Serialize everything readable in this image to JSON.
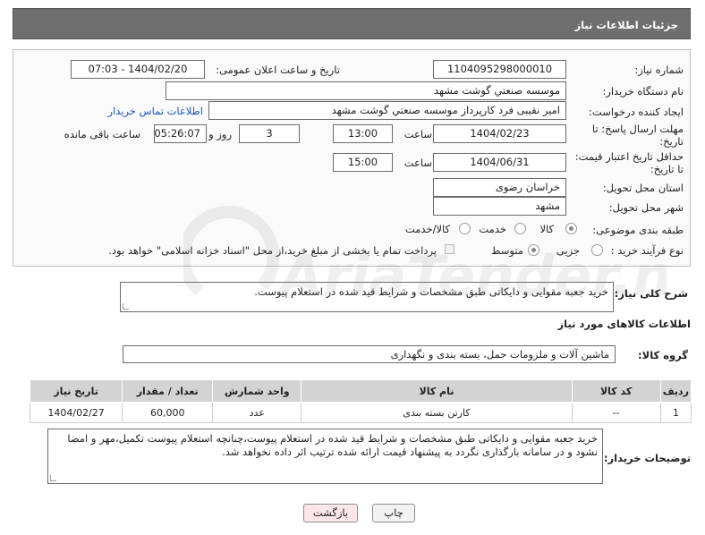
{
  "header": {
    "title": "جزئیات اطلاعات نیاز"
  },
  "form": {
    "need_number_label": "شماره نیاز:",
    "need_number": "1104095298000010",
    "announce_label": "تاریخ و ساعت اعلان عمومی:",
    "announce_value": "1404/02/20 - 07:03",
    "buyer_org_label": "نام دستگاه خریدار:",
    "buyer_org": "موسسه صنعتي گوشت مشهد",
    "requester_label": "ایجاد کننده درخواست:",
    "requester": "امیر نقیبی فرد کارپرداز موسسه صنعتي گوشت مشهد",
    "contact_link": "اطلاعات تماس خریدار",
    "deadline_label_1": "مهلت ارسال پاسخ: تا",
    "deadline_label_2": "تاریخ:",
    "deadline_date": "1404/02/23",
    "time_label": "ساعت",
    "deadline_time": "13:00",
    "days_value": "3",
    "days_label": "روز و",
    "remaining_time": "05:26:07",
    "remaining_label": "ساعت باقی مانده",
    "validity_label_1": "حداقل تاریخ اعتبار قیمت:",
    "validity_label_2": "تا تاریخ:",
    "validity_date": "1404/06/31",
    "validity_time": "15:00",
    "province_label": "استان محل تحویل:",
    "province": "خراسان رضوی",
    "city_label": "شهر محل تحویل:",
    "city": "مشهد",
    "category_label": "طبقه بندی موضوعی:",
    "category_options": [
      "کالا",
      "خدمت",
      "کالا/خدمت"
    ],
    "category_selected": 0,
    "process_label": "نوع فرآیند خرید :",
    "process_options": [
      "جزیی",
      "متوسط"
    ],
    "process_selected": 1,
    "payment_note": "پرداخت تمام یا بخشی از مبلغ خرید،از محل \"اسناد خزانه اسلامی\" خواهد بود."
  },
  "description": {
    "label": "شرح کلی نیاز:",
    "text": "خرید جعبه مقوایی و دایکاتی طبق مشخصات و شرایط قید شده در استعلام پیوست."
  },
  "goods": {
    "section_title": "اطلاعات کالاهای مورد نیاز",
    "group_label": "گروه کالا:",
    "group_value": "ماشین آلات و ملزومات حمل، بسته بندی و نگهداری",
    "columns": [
      "ردیف",
      "کد کالا",
      "نام کالا",
      "واحد شمارش",
      "تعداد / مقدار",
      "تاریخ نیاز"
    ],
    "rows": [
      {
        "row": "1",
        "code": "--",
        "name": "کارتن بسته بندی",
        "unit": "عدد",
        "qty": "60,000",
        "date": "1404/02/27"
      }
    ]
  },
  "buyer_notes": {
    "label": "توضیحات خریدار:",
    "text": "خرید جعبه مقوایی و دایکاتی طبق مشخصات و شرایط قید شده در استعلام پیوست،چنانچه استعلام پیوست تکمیل،مهر و امضا نشود و در سامانه بارگذاری نگردد به پیشنهاد قیمت ارائه شده ترتیب اثر داده نخواهد شد."
  },
  "buttons": {
    "print": "چاپ",
    "back": "بازگشت"
  },
  "watermark": {
    "text": "AriaTender.net"
  },
  "colors": {
    "header_bg": "#6f6f6f",
    "link": "#1a56c7",
    "back_button_bg": "#fbe7e7",
    "table_header_bg": "#d3d3d3"
  }
}
